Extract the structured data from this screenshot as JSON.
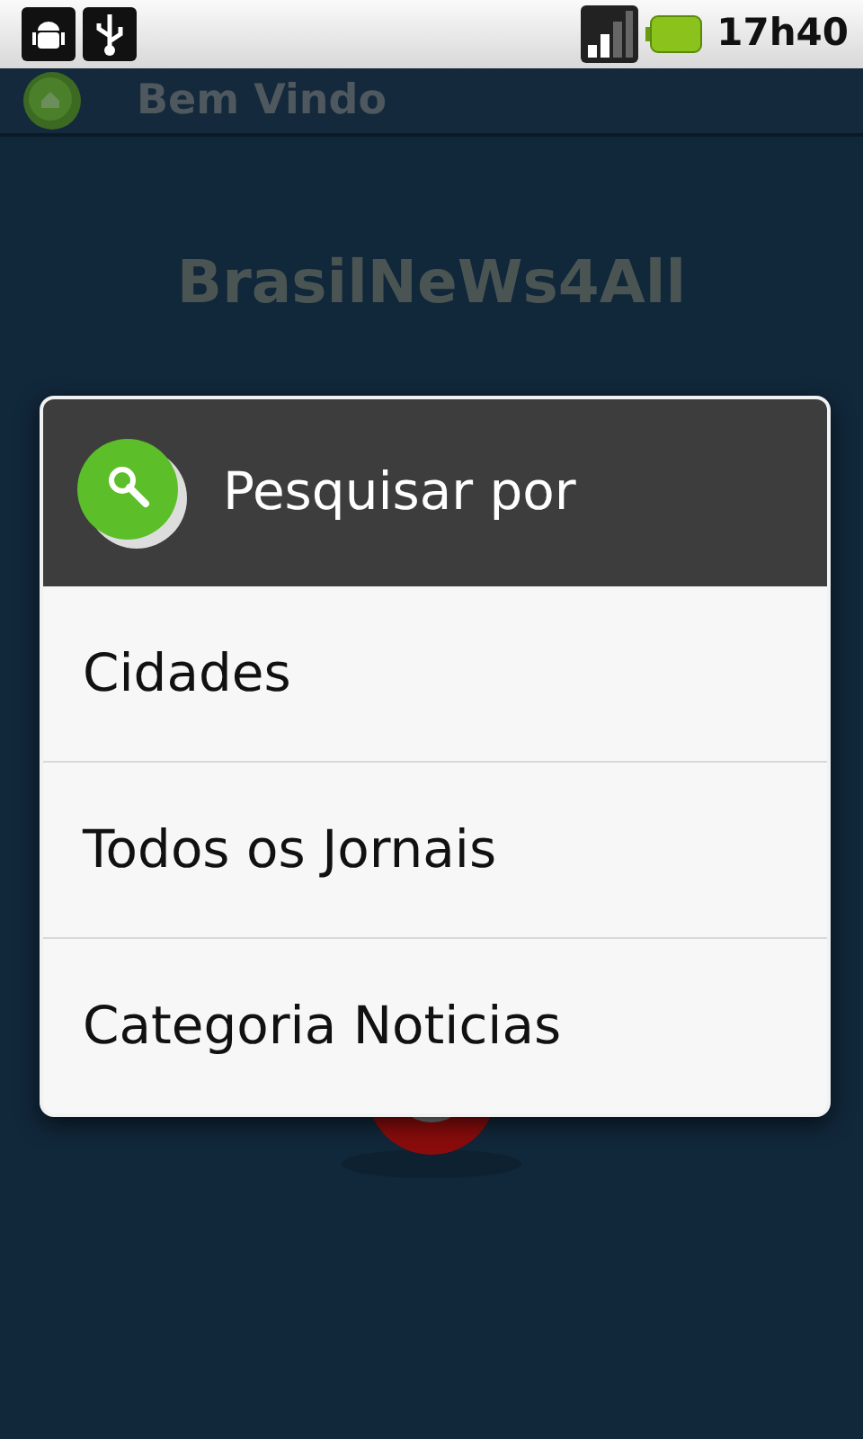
{
  "status_bar": {
    "time": "17h40"
  },
  "title_bar": {
    "title": "Bem Vindo"
  },
  "app_title": "BrasilNeWs4All",
  "dialog": {
    "title": "Pesquisar por",
    "items": [
      {
        "label": "Cidades"
      },
      {
        "label": "Todos os Jornais"
      },
      {
        "label": "Categoria Noticias"
      }
    ]
  }
}
